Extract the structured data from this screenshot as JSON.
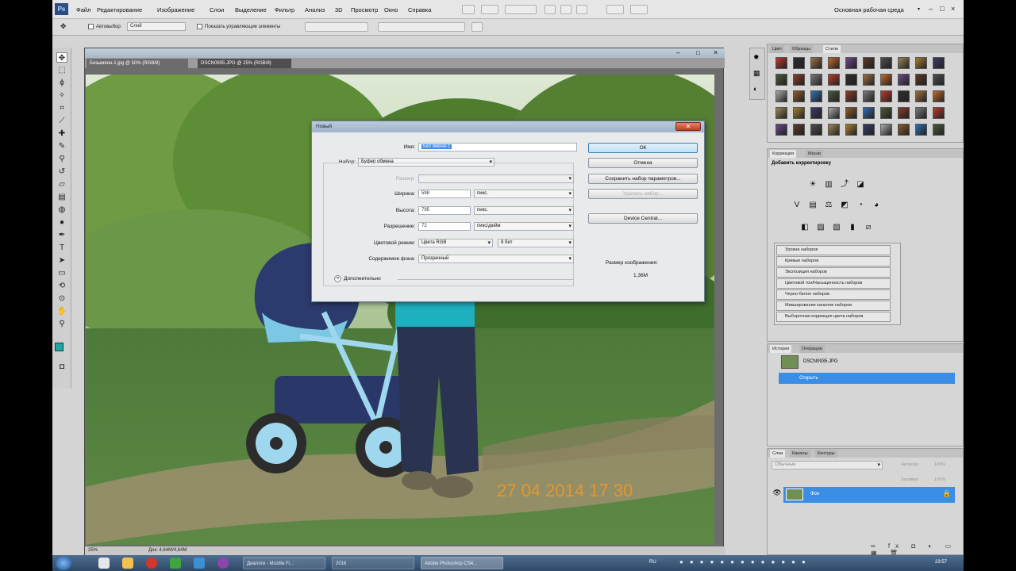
{
  "app": {
    "menu": [
      "Файл",
      "Редактирование",
      "Изображение",
      "Слои",
      "Выделение",
      "Фильтр",
      "Анализ",
      "3D",
      "Просмотр",
      "Окно",
      "Справка"
    ],
    "workspace": "Основная рабочая среда",
    "window_controls": [
      "–",
      "□",
      "×"
    ]
  },
  "options_bar": {
    "autoselect": "Автовыбор:",
    "autoselect_value": "Слой",
    "show_controls": "Показать управляющие элементы"
  },
  "document": {
    "tabs": [
      "Безымянн-1.jpg @ 50% (RGB/8)",
      "DSCN0935.JPG @ 25% (RGB/8)"
    ],
    "zoom": "25%",
    "doc_info": "Док: 4,64М/4,64М",
    "photo_timestamp": "27 04 2014 17 30",
    "timestamp_color": "#e8962b"
  },
  "dialog": {
    "title": "Новый",
    "name_label": "Имя:",
    "name_value": "Без имени-1",
    "preset_label": "Набор:",
    "preset_value": "Буфер обмена",
    "size_label": "Размер:",
    "width_label": "Ширина:",
    "width_value": "598",
    "width_unit": "пикс.",
    "height_label": "Высота:",
    "height_value": "795",
    "height_unit": "пикс.",
    "resolution_label": "Разрешение:",
    "resolution_value": "72",
    "resolution_unit": "пикс/дюйм",
    "color_mode_label": "Цветовой режим:",
    "color_mode_value": "Цвета RGB",
    "bit_depth": "8 бит",
    "bg_label": "Содержимое фона:",
    "bg_value": "Прозрачный",
    "advanced": "Дополнительно",
    "ok": "ОК",
    "cancel": "Отмена",
    "save_preset": "Сохранить набор параметров...",
    "delete_preset": "Удалить набор...",
    "device_central": "Device Central...",
    "image_size_label": "Размер изображения:",
    "image_size_value": "1,36М"
  },
  "panels": {
    "swatches_tabs": [
      "Цвет",
      "Образцы",
      "Стили"
    ],
    "adjustments_tabs": [
      "Коррекция",
      "Маски"
    ],
    "adjustments_title": "Добавить корректировку",
    "presets": [
      "Уровни наборов",
      "Кривые наборов",
      "Экспозиция наборов",
      "Цветовой тон/Насыщенность наборов",
      "Черно-белое наборов",
      "Микширование каналов наборов",
      "Выборочная коррекция цвета наборов"
    ],
    "history_tabs": [
      "История",
      "Операции"
    ],
    "history_snapshot": "DSCN0935.JPG",
    "history_item": "Открыть",
    "layers_tabs": [
      "Слои",
      "Каналы",
      "Контуры"
    ],
    "blend_mode": "Обычные",
    "opacity_label": "Непрозр.:",
    "opacity_value": "100%",
    "fill_label": "Заливка:",
    "fill_value": "100%",
    "layer_name": "Фон"
  },
  "taskbar": {
    "tasks": [
      "Диалоги - Mozilla Fi...",
      "2016",
      "Adobe Photoshop CS4..."
    ],
    "lang": "RU",
    "time": "23:57"
  },
  "colors": {
    "accent": "#3c8ee0",
    "selection": "#3a8ee6",
    "dialog_bg": "#e9eaec"
  }
}
